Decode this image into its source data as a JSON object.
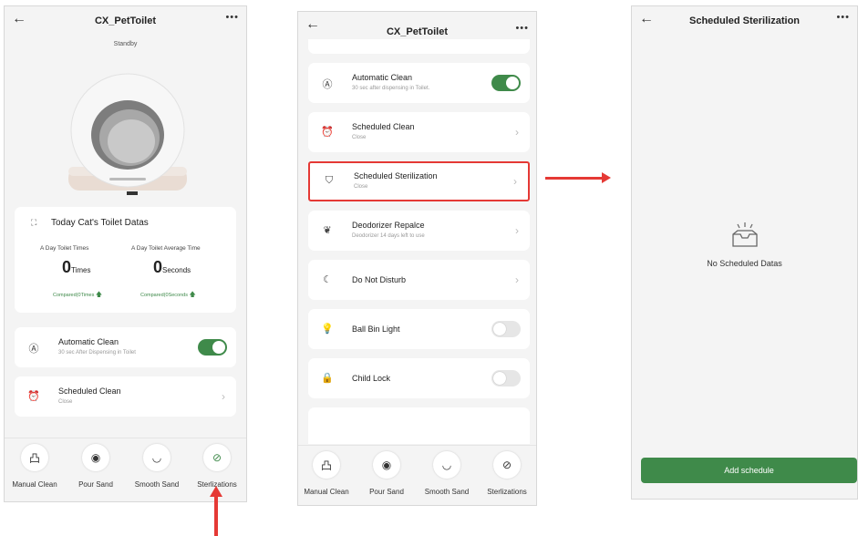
{
  "colors": {
    "accent_green": "#3f8a4a",
    "highlight_red": "#e53935"
  },
  "screen1": {
    "back_icon": "arrow-left-icon",
    "title": "CX_PetToilet",
    "status": "Standby",
    "stats": {
      "heading": "Today Cat's Toilet Datas",
      "times_label": "A Day Toilet Times",
      "avg_label": "A Day Toilet Average Time",
      "times_value": "0",
      "times_unit": "Times",
      "avg_value": "0",
      "avg_unit": "Seconds",
      "times_compare": "Compared(0Times",
      "avg_compare": "Compared(0Seconds"
    },
    "auto_clean": {
      "title": "Automatic Clean",
      "sub": "30 sec After Dispensing in Toilet",
      "on": true
    },
    "scheduled_clean": {
      "title": "Scheduled Clean",
      "sub": "Close"
    },
    "tabs": [
      "Manual Clean",
      "Pour Sand",
      "Smooth Sand",
      "Sterlizations"
    ]
  },
  "screen2": {
    "title": "CX_PetToilet",
    "rows": [
      {
        "title": "Automatic Clean",
        "sub": "30 sec after dispensing in Toilet.",
        "control": "toggle-on"
      },
      {
        "title": "Scheduled Clean",
        "sub": "Close",
        "control": "chevron"
      },
      {
        "title": "Scheduled Sterilization",
        "sub": "Close",
        "control": "chevron",
        "highlighted": true
      },
      {
        "title": "Deodorizer Repalce",
        "sub": "Deodorizer 14 days left to use",
        "control": "chevron"
      },
      {
        "title": "Do Not Disturb",
        "sub": "",
        "control": "chevron"
      },
      {
        "title": "Ball Bin Light",
        "sub": "",
        "control": "toggle-off"
      },
      {
        "title": "Child Lock",
        "sub": "",
        "control": "toggle-off"
      }
    ],
    "tabs": [
      "Manual Clean",
      "Pour Sand",
      "Smooth Sand",
      "Sterlizations"
    ]
  },
  "screen3": {
    "title": "Scheduled Sterilization",
    "empty_text": "No Scheduled Datas",
    "add_button": "Add schedule"
  }
}
